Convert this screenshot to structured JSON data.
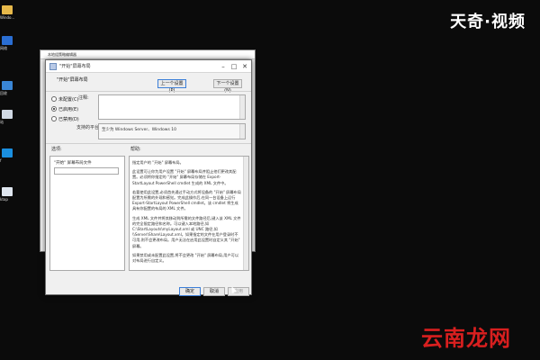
{
  "watermarks": {
    "top": "天奇·视频",
    "bottom": "云南龙网"
  },
  "desktop_icons": [
    {
      "label": "Windo...",
      "icon": "folder-icon"
    },
    {
      "label": "网络",
      "icon": "network-icon"
    },
    {
      "label": "回收",
      "icon": "recycle-bin-icon"
    },
    {
      "label": "站",
      "icon": "app-icon"
    },
    {
      "label": "f",
      "icon": "app-icon"
    },
    {
      "label": "ktop",
      "icon": "app-icon"
    }
  ],
  "back_window": {
    "title": "本地组策略编辑器"
  },
  "dialog": {
    "title": "\"开始\"屏幕布局",
    "header": "\"开始\"屏幕布局",
    "buttons": {
      "prev": "上一个设置(P)",
      "next": "下一个设置(N)",
      "ok": "确定",
      "cancel": "取消",
      "apply": "应用"
    },
    "radios": [
      {
        "label": "未配置(C)",
        "checked": false
      },
      {
        "label": "已启用(E)",
        "checked": true
      },
      {
        "label": "已禁用(D)",
        "checked": false
      }
    ],
    "comment_label": "注释:",
    "supported_label": "支持的平台:",
    "supported_value": "至少为 Windows Server、Windows 10",
    "options_label": "选项:",
    "help_label": "帮助:",
    "option_field_label": "\"开始\" 屏幕布局文件",
    "help_paragraphs": [
      "指定用户的 \"开始\" 屏幕布局。",
      "此设置可让你为用户设置 \"开始\" 屏幕布局并阻止他们更改其配置。必须将你指定的 \"开始\" 屏幕布局存储在 Export-StartLayout PowerShell cmdlet 生成的 XML 文件中。",
      "若要使用此设置,必须首先通过手动方式将设备的 \"开始\" 屏幕布局配置为所需的外观和感觉。完成此操作后,在同一台设备上运行 Export-StartLayout PowerShell cmdlet。该 cmdlet 将生成具有你配置的布局的 XML 文件。",
      "生成 XML 文件并将其移动到所需的文件路径后,键入该 XML 文件的完全限定路径和名称。可以键入本地路径,如 C:\\StartLayouts\\myLayout.xml 或 UNC 路径,如 \\\\Server\\Share\\Layout.xml。如果指定的文件在用户登录时不可用,则不会更改布局。用户无法在启用此设置时自定义其 \"开始\" 屏幕。",
      "如果禁用或未配置此设置,将不会更改 \"开始\" 屏幕布局,用户可以对布局进行自定义。"
    ]
  }
}
